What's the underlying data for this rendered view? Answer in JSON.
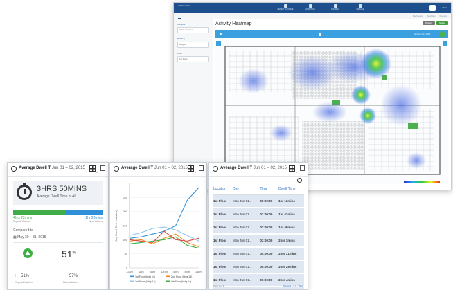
{
  "heatmap_window": {
    "brand": "CISCO\nCMX",
    "nav": [
      "DETECT & LOCATE",
      "ANALYTICS",
      "CONNECT",
      "MANAGE"
    ],
    "user": "admin",
    "subnav": [
      "Dashboard",
      "Analytics",
      "Reports"
    ],
    "left_panel": [
      {
        "label": "Campus",
        "value": "Cisco Campus"
      },
      {
        "label": "Building",
        "value": "Bldg 14"
      },
      {
        "label": "Floor",
        "value": "1st Floor"
      }
    ],
    "title": "Activity Heatmap",
    "buttons": [
      "Playback",
      "Settings"
    ],
    "selected": "Mon Jun 01, 2015"
  },
  "card1": {
    "title": "Average Dwell T",
    "date": "Jun 01 – 02, 2015",
    "dwell_time": "3HRS 50MINS",
    "dwell_subtitle": "Average Dwell Time of All ...",
    "repeat_time": "4hrs 22mins",
    "repeat_label": "Repeat Visitors",
    "new_time": "1hr 28mins",
    "new_label": "New Visitors",
    "split_repeat_fraction": 0.6,
    "compared_label": "Compared to",
    "compared_date": "May 30 – 31, 2015",
    "change_pct": "51",
    "change_unit": "%",
    "sub_items": [
      {
        "value": "51%",
        "label": "Repeat Visitors"
      },
      {
        "value": "57%",
        "label": "New Visitors"
      }
    ]
  },
  "card2": {
    "title": "Average Dwell T",
    "date": "Jun 01 – 02, 2015"
  },
  "card3": {
    "title": "Average Dwell T",
    "date": "Jun 01 – 02, 2015",
    "columns": [
      "Location",
      "Day",
      "Time",
      "Dwell Time"
    ],
    "rows": [
      [
        "1st Floor",
        "Mon Jun 01...",
        "00:00:00",
        "1hr 13mins"
      ],
      [
        "1st Floor",
        "Mon Jun 01...",
        "01:00:00",
        "1hr 41mins"
      ],
      [
        "1st Floor",
        "Mon Jun 01...",
        "02:00:00",
        "1hr 49mins"
      ],
      [
        "1st Floor",
        "Mon Jun 01...",
        "03:00:00",
        "2hrs 3mins"
      ],
      [
        "1st Floor",
        "Mon Jun 01...",
        "04:00:00",
        "2hrs 31mins"
      ],
      [
        "1st Floor",
        "Mon Jun 01...",
        "05:00:00",
        "2hrs 29mins"
      ],
      [
        "1st Floor",
        "Mon Jun 01...",
        "06:00:00",
        "2hrs 4mins"
      ],
      [
        "1st Floor",
        "Mon Jun 01...",
        "07:00:00",
        "2hrs 6mins"
      ]
    ],
    "pager": "Page 1 of 4",
    "pager_right": "Previous 1 2 3 ... Next"
  },
  "chart_data": {
    "type": "line",
    "title": "",
    "xlabel": "",
    "ylabel": "Avg Dwell Time (minutes)",
    "x": [
      "12am",
      "4am",
      "8am",
      "12pm",
      "4pm",
      "8pm",
      "11pm"
    ],
    "ylim": [
      0,
      300
    ],
    "yticks": [
      0,
      50,
      100,
      150,
      200,
      250
    ],
    "series": [
      {
        "name": "1st Floor (bldg 14)",
        "color": "#2f8fd8",
        "values": [
          105,
          110,
          120,
          130,
          150,
          240,
          285
        ]
      },
      {
        "name": "2nd Floor (bldg 14)",
        "color": "#f08a24",
        "values": [
          95,
          100,
          85,
          105,
          120,
          90,
          75
        ]
      },
      {
        "name": "3rd Floor (bldg 14)",
        "color": "#8fc7ee",
        "values": [
          115,
          125,
          140,
          145,
          135,
          115,
          95
        ]
      },
      {
        "name": "4th Floor (bldg 14)",
        "color": "#3fae49",
        "values": [
          85,
          90,
          95,
          100,
          110,
          80,
          70
        ]
      },
      {
        "name": "",
        "color": "#d7463c",
        "values": [
          100,
          95,
          90,
          130,
          100,
          95,
          105
        ]
      }
    ]
  },
  "colors": {
    "brand_blue": "#1d4f8c",
    "accent_blue": "#3aa0e0",
    "repeat_green": "#3fae49",
    "new_blue": "#2f8fd8"
  }
}
